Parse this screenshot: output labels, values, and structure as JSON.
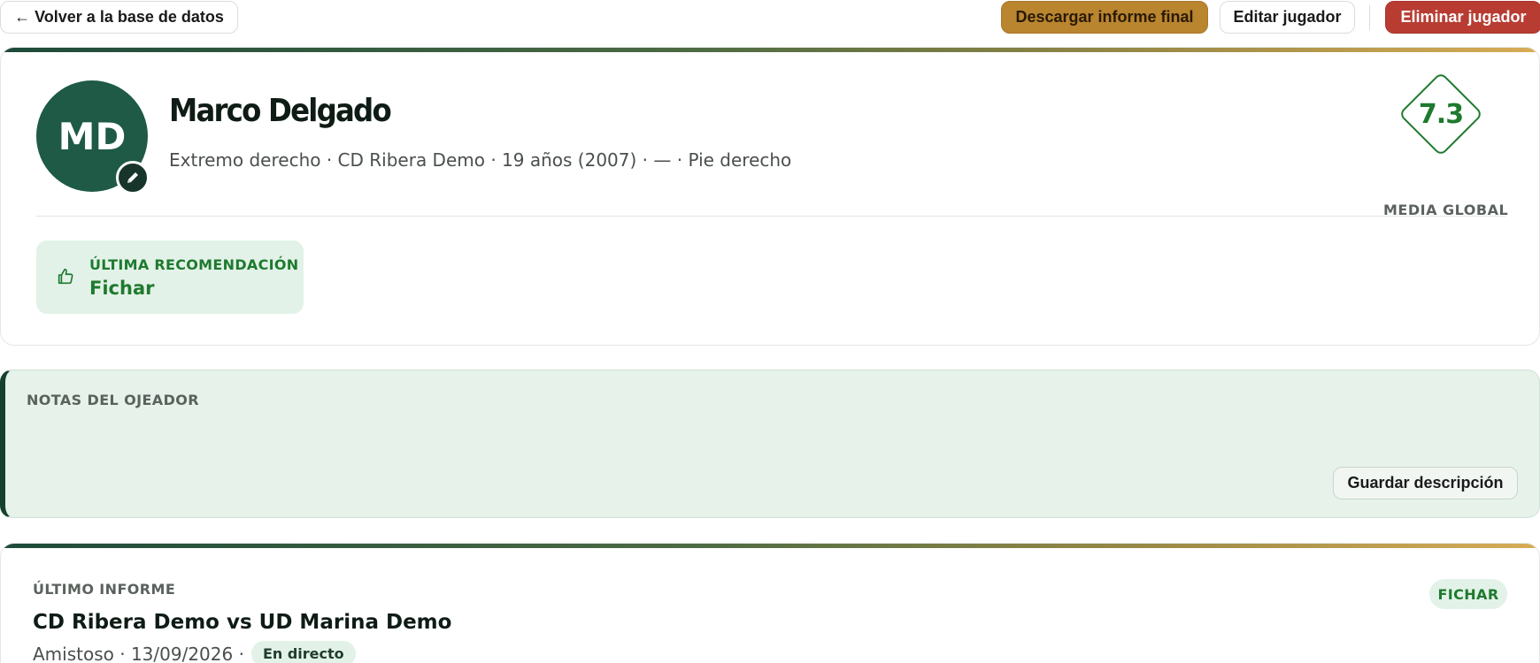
{
  "topbar": {
    "back_label": "← Volver a la base de datos",
    "download_label": "Descargar informe final",
    "edit_label": "Editar jugador",
    "delete_label": "Eliminar jugador"
  },
  "player": {
    "initials": "MD",
    "name": "Marco Delgado",
    "meta": "Extremo derecho · CD Ribera Demo · 19 años (2007) · — · Pie derecho",
    "rating": "7.3",
    "rating_label": "MEDIA GLOBAL",
    "edit_avatar_icon": "pencil-icon",
    "recommendation_label": "ÚLTIMA RECOMENDACIÓN",
    "recommendation_value": "Fichar",
    "recommendation_icon": "thumbs-up-icon"
  },
  "notes": {
    "label": "NOTAS DEL OJEADOR",
    "save_label": "Guardar descripción"
  },
  "last_report": {
    "label": "ÚLTIMO INFORME",
    "title": "CD Ribera Demo vs UD Marina Demo",
    "meta": "Amistoso · 13/09/2026 ·",
    "live_badge": "En directo",
    "recommendation_badge": "FICHAR"
  },
  "colors": {
    "brand_green": "#1e5a45",
    "accent_green": "#1e7a2e",
    "gold": "#b9852f",
    "danger": "#b83c32",
    "dark_green": "#17412f"
  }
}
